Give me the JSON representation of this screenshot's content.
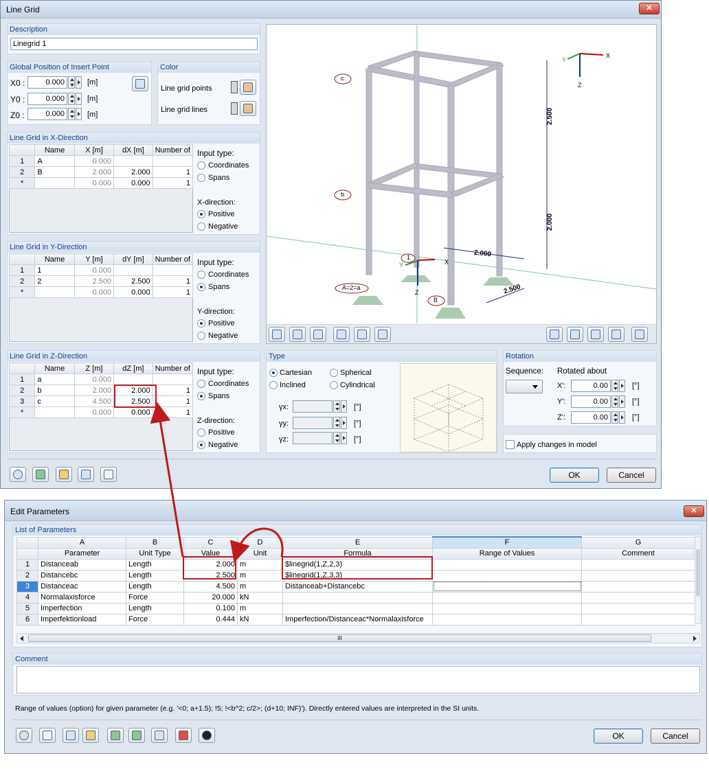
{
  "line_grid_dialog": {
    "title": "Line Grid",
    "close": "✕",
    "description": {
      "title": "Description",
      "value": "Linegrid 1"
    },
    "global_position": {
      "title": "Global Position of Insert Point",
      "x_label": "X0 :",
      "x_value": "0.000",
      "y_label": "Y0 :",
      "y_value": "0.000",
      "z_label": "Z0 :",
      "z_value": "0.000",
      "unit": "[m]"
    },
    "color": {
      "title": "Color",
      "points_label": "Line grid points",
      "lines_label": "Line grid lines"
    },
    "x_grid": {
      "title": "Line Grid in X-Direction",
      "headers": [
        "",
        "Name",
        "X [m]",
        "dX [m]",
        "Number of"
      ],
      "rows": [
        [
          "1",
          "A",
          "0.000",
          "",
          ""
        ],
        [
          "2",
          "B",
          "2.000",
          "2.000",
          "1"
        ],
        [
          "*",
          "",
          "0.000",
          "0.000",
          "1"
        ]
      ],
      "input_type_label": "Input type:",
      "opt1": "Coordinates",
      "opt2": "Spans",
      "dir_label": "X-direction:",
      "dir1": "Positive",
      "dir2": "Negative"
    },
    "y_grid": {
      "title": "Line Grid in Y-Direction",
      "headers": [
        "",
        "Name",
        "Y [m]",
        "dY [m]",
        "Number of"
      ],
      "rows": [
        [
          "1",
          "1",
          "0.000",
          "",
          ""
        ],
        [
          "2",
          "2",
          "2.500",
          "2.500",
          "1"
        ],
        [
          "*",
          "",
          "0.000",
          "0.000",
          "1"
        ]
      ],
      "input_type_label": "Input type:",
      "opt1": "Coordinates",
      "opt2": "Spans",
      "dir_label": "Y-direction:",
      "dir1": "Positive",
      "dir2": "Negative"
    },
    "z_grid": {
      "title": "Line Grid in Z-Direction",
      "headers": [
        "",
        "Name",
        "Z [m]",
        "dZ [m]",
        "Number of"
      ],
      "rows": [
        [
          "1",
          "a",
          "0.000",
          "",
          ""
        ],
        [
          "2",
          "b",
          "2.000",
          "2.000",
          "1"
        ],
        [
          "3",
          "c",
          "4.500",
          "2.500",
          "1"
        ],
        [
          "*",
          "",
          "0.000",
          "0.000",
          "1"
        ]
      ],
      "input_type_label": "Input type:",
      "opt1": "Coordinates",
      "opt2": "Spans",
      "dir_label": "Z-direction:",
      "dir1": "Positive",
      "dir2": "Negative"
    },
    "viewport": {
      "dim_vertical_top": "2.500",
      "dim_vertical_bottom": "2.000",
      "dim_x": "2.000",
      "dim_y": "2.500",
      "label_c": "c",
      "label_b": "b",
      "label_a": "A=2=a",
      "label_B": "B",
      "label_1": "1",
      "axis_x": "X",
      "axis_y": "Y",
      "axis_z": "Z"
    },
    "type": {
      "title": "Type",
      "cartesian": "Cartesian",
      "spherical": "Spherical",
      "inclined": "Inclined",
      "cylindrical": "Cylindrical",
      "gx": "γx:",
      "gy": "γy:",
      "gz": "γz:",
      "unit": "[°]"
    },
    "rotation": {
      "title": "Rotation",
      "sequence_label": "Sequence:",
      "rotated_about": "Rotated about",
      "x_label": "X':",
      "x_value": "0.00",
      "y_label": "Y':",
      "y_value": "0.00",
      "z_label": "Z':",
      "z_value": "0.00",
      "unit": "[°]",
      "apply_label": "Apply changes in model"
    },
    "ok": "OK",
    "cancel": "Cancel"
  },
  "edit_parameters": {
    "title": "Edit Parameters",
    "close": "✕",
    "list_title": "List of Parameters",
    "col_letters": [
      "",
      "A",
      "B",
      "C",
      "D",
      "E",
      "F",
      "G"
    ],
    "headers": [
      "",
      "Parameter",
      "Unit Type",
      "Value",
      "Unit",
      "Formula",
      "Range of Values",
      "Comment"
    ],
    "rows": [
      [
        "1",
        "Distanceab",
        "Length",
        "2.000",
        "m",
        "$linegrid(1,Z,2,3)",
        "",
        ""
      ],
      [
        "2",
        "Distancebc",
        "Length",
        "2.500",
        "m",
        "$linegrid(1,Z,3,3)",
        "",
        ""
      ],
      [
        "3",
        "Distanceac",
        "Length",
        "4.500",
        "m",
        "Distanceab+Distancebc",
        "",
        ""
      ],
      [
        "4",
        "Normalaxisforce",
        "Force",
        "20.000",
        "kN",
        "",
        "",
        ""
      ],
      [
        "5",
        "Imperfection",
        "Length",
        "0.100",
        "m",
        "",
        "",
        ""
      ],
      [
        "6",
        "Imperfektionload",
        "Force",
        "0.444",
        "kN",
        "Imperfection/Distanceac*Normalaxisforce",
        "",
        ""
      ]
    ],
    "scroll_mid": "III",
    "comment_title": "Comment",
    "hint": "Range of values (option) for given parameter (e.g. '<0; a+1.5); !5; !<b^2; c/2>; (d+10; INF)'). Directly entered values are interpreted in the SI units.",
    "ok": "OK",
    "cancel": "Cancel"
  }
}
